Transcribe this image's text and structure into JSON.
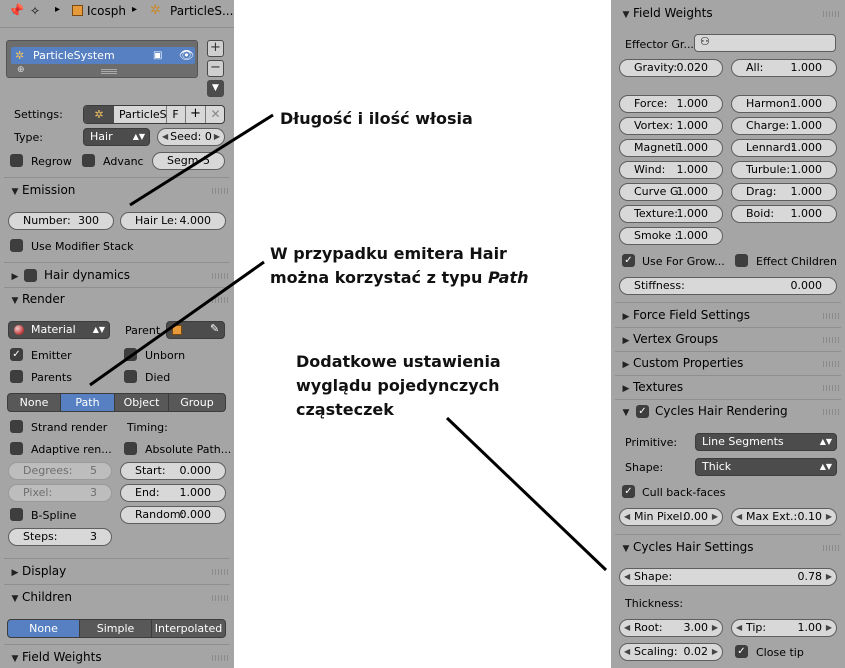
{
  "left": {
    "header": {
      "object": "Icosph",
      "system": "ParticleS..."
    },
    "list": {
      "item": "ParticleSystem"
    },
    "settings_label": "Settings:",
    "settings_name": "ParticleS",
    "settings_f": "F",
    "type_label": "Type:",
    "type_value": "Hair",
    "seed": "Seed: 0",
    "regrow": "Regrow",
    "advanced": "Advanc",
    "segments": "Segm",
    "segments_val": "5",
    "emission": "Emission",
    "number_k": "Number:",
    "number_v": "300",
    "hairlen_k": "Hair Le:",
    "hairlen_v": "4.000",
    "use_modifier": "Use Modifier Stack",
    "hair_dynamics": "Hair dynamics",
    "render": "Render",
    "material": "Material",
    "parent": "Parent",
    "emitter": "Emitter",
    "unborn": "Unborn",
    "parents": "Parents",
    "died": "Died",
    "render_modes": [
      "None",
      "Path",
      "Object",
      "Group"
    ],
    "strand_render": "Strand render",
    "timing": "Timing:",
    "adaptive": "Adaptive ren...",
    "absolute_path": "Absolute Path...",
    "degrees_k": "Degrees:",
    "degrees_v": "5",
    "start_k": "Start:",
    "start_v": "0.000",
    "pixel_k": "Pixel:",
    "pixel_v": "3",
    "end_k": "End:",
    "end_v": "1.000",
    "bspline": "B-Spline",
    "random_k": "Random:",
    "random_v": "0.000",
    "steps_k": "Steps:",
    "steps_v": "3",
    "display": "Display",
    "children": "Children",
    "child_modes": [
      "None",
      "Simple",
      "Interpolated"
    ],
    "field_weights": "Field Weights"
  },
  "notes": {
    "n1": "Długość i ilość włosia",
    "n2a": "W przypadku emitera Hair",
    "n2b": "można korzystać z typu ",
    "n2c": "Path",
    "n3a": "Dodatkowe ustawienia",
    "n3b": "wyglądu pojedynczych",
    "n3c": "cząsteczek"
  },
  "right": {
    "field_weights": "Field Weights",
    "effector": "Effector Gr...",
    "gravity_k": "Gravity:",
    "gravity_v": "0.020",
    "all_k": "All:",
    "all_v": "1.000",
    "weights": [
      [
        "Force:",
        "1.000",
        "Harmon:",
        "1.000"
      ],
      [
        "Vortex:",
        "1.000",
        "Charge:",
        "1.000"
      ],
      [
        "Magneti:",
        "1.000",
        "Lennard:",
        "1.000"
      ],
      [
        "Wind:",
        "1.000",
        "Turbule:",
        "1.000"
      ],
      [
        "Curve G:",
        "1.000",
        "Drag:",
        "1.000"
      ],
      [
        "Texture:",
        "1.000",
        "Boid:",
        "1.000"
      ]
    ],
    "smoke_k": "Smoke :",
    "smoke_v": "1.000",
    "use_for_growing": "Use For Grow...",
    "effect_children": "Effect Children",
    "stiffness_k": "Stiffness:",
    "stiffness_v": "0.000",
    "force_field": "Force Field Settings",
    "vertex_groups": "Vertex Groups",
    "custom_props": "Custom Properties",
    "textures": "Textures",
    "cycles_rendering": "Cycles Hair Rendering",
    "primitive_label": "Primitive:",
    "primitive_value": "Line Segments",
    "shape_label": "Shape:",
    "shape_value": "Thick",
    "cull": "Cull back-faces",
    "minpix_k": "Min Pixel:",
    "minpix_v": "0.00",
    "maxext_k": "Max Ext.:",
    "maxext_v": "0.10",
    "cycles_settings": "Cycles Hair Settings",
    "shape2_k": "Shape:",
    "shape2_v": "0.78",
    "thickness": "Thickness:",
    "root_k": "Root:",
    "root_v": "3.00",
    "tip_k": "Tip:",
    "tip_v": "1.00",
    "scaling_k": "Scaling:",
    "scaling_v": "0.02",
    "close_tip": "Close tip"
  }
}
